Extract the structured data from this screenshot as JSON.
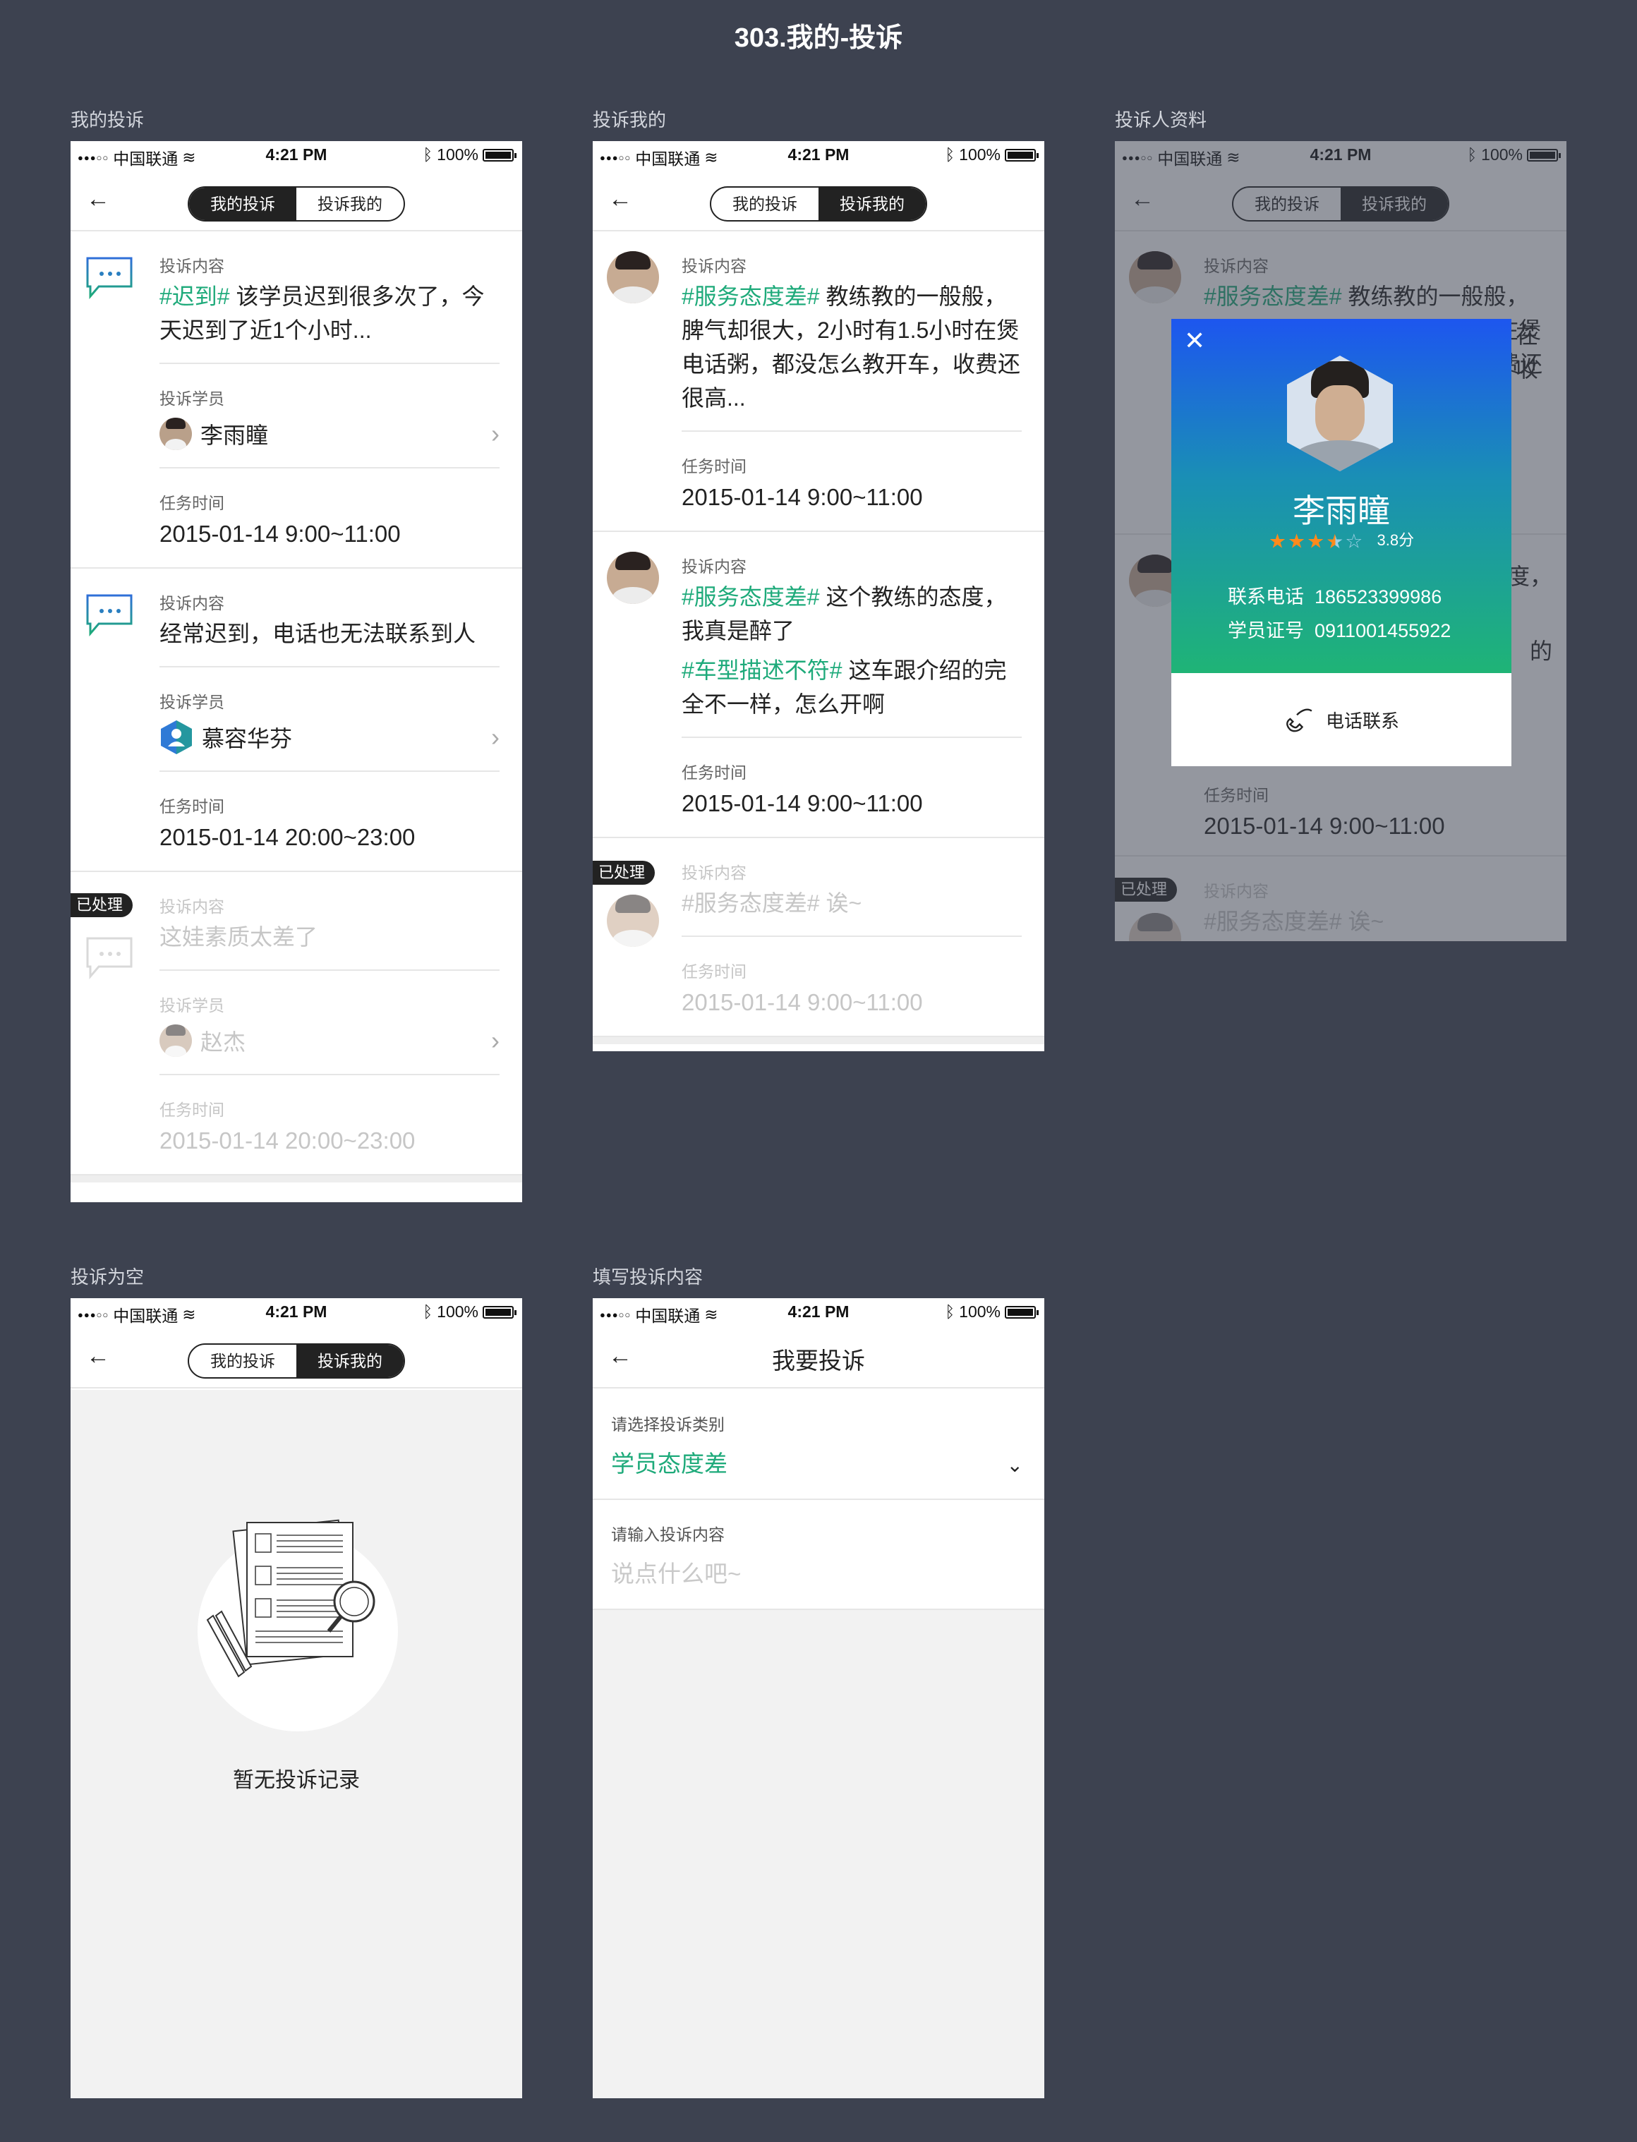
{
  "page_title": "303.我的-投诉",
  "status": {
    "carrier": "中国联通",
    "time": "4:21 PM",
    "battery": "100%"
  },
  "seg": {
    "mine": "我的投诉",
    "about_me": "投诉我的"
  },
  "labels": {
    "content": "投诉内容",
    "student": "投诉学员",
    "task_time": "任务时间",
    "done": "已处理"
  },
  "screens": {
    "s1": "我的投诉",
    "s2": "投诉我的",
    "s3": "投诉人资料",
    "s4": "投诉为空",
    "s5": "填写投诉内容"
  },
  "my_complaints": [
    {
      "tag": "#迟到#",
      "text": " 该学员迟到很多次了，今天迟到了近1个小时...",
      "student": "李雨瞳",
      "time": "2015-01-14 9:00~11:00"
    },
    {
      "tag": "",
      "text": "经常迟到，电话也无法联系到人",
      "student": "慕容华芬",
      "time": "2015-01-14 20:00~23:00"
    },
    {
      "tag": "",
      "text": "这娃素质太差了",
      "student": "赵杰",
      "time": "2015-01-14 20:00~23:00"
    }
  ],
  "about_me": [
    {
      "tag": "#服务态度差#",
      "text": " 教练教的一般般，脾气却很大，2小时有1.5小时在煲电话粥，都没怎么教开车，收费还很高...",
      "time": "2015-01-14 9:00~11:00"
    },
    {
      "tag": "#服务态度差#",
      "text": " 这个教练的态度，我真是醉了",
      "tag2": "#车型描述不符#",
      "text2": " 这车跟介绍的完全不一样，怎么开啊",
      "time": "2015-01-14 9:00~11:00"
    },
    {
      "tag": "#服务态度差#",
      "text": " 诶~",
      "time": "2015-01-14 9:00~11:00"
    }
  ],
  "profile": {
    "close": "✕",
    "name": "李雨瞳",
    "rating": 3.8,
    "rating_text": "3.8分",
    "phone_label": "联系电话",
    "phone": "186523399986",
    "id_label": "学员证号",
    "id": "0911001455922",
    "call": "电话联系",
    "bg_fragments": {
      "a": "在",
      "b": "收",
      "c": "度，",
      "d": "的"
    }
  },
  "empty": {
    "text": "暂无投诉记录"
  },
  "form": {
    "title": "我要投诉",
    "type_label": "请选择投诉类别",
    "type_value": "学员态度差",
    "content_label": "请输入投诉内容",
    "content_placeholder": "说点什么吧~"
  },
  "colors": {
    "background": "#3d4250",
    "accent": "#1eaa7a",
    "dark": "#222222"
  }
}
